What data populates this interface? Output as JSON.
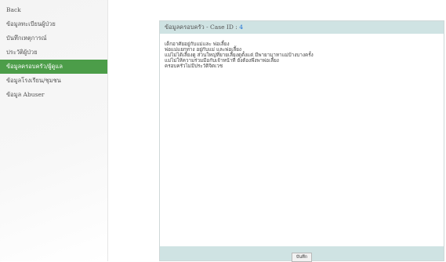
{
  "sidebar": {
    "items": [
      {
        "label": "Back",
        "active": false
      },
      {
        "label": "ข้อมูลทะเบียนผู้ป่วย",
        "active": false
      },
      {
        "label": "บันทึกเหตุการณ์",
        "active": false
      },
      {
        "label": "ประวัติผู้ป่วย",
        "active": false
      },
      {
        "label": "ข้อมูลครอบครัว/ผู้ดูแล",
        "active": true
      },
      {
        "label": "ข้อมูลโรงเรียน/ชุมชน",
        "active": false
      },
      {
        "label": "ข้อมูล Abuser",
        "active": false
      }
    ]
  },
  "panel": {
    "title_prefix": "ข้อมูลครอบครัว - Case ID : ",
    "case_id": "4",
    "notes": [
      "เด็กอาศัยอยู่กับแม่และ พ่อเลี้ยง",
      "พ่อแม่แยกทาง อยู่กับแม่ และพ่อเลี้ยง",
      "แม่ไม่ได้เลี้ยงดู ส่วนใหญ่ที่ยายเลี้ยงดูตั้งแต่ มีพายามาหาแม่บ้างบางครั้ง",
      "แม่ไม่ให้ความร่วมมือกับเจ้าหน้าที่ ยังต้องพึ่งพาพ่อเลี้ยง",
      "ครอบครัวไม่มีประวัติจิตเวช"
    ],
    "save_label": "บันทึก"
  },
  "colors": {
    "active_green": "#4c9d49",
    "header_teal": "#cfe3e3",
    "case_id_blue": "#1a6fd6"
  }
}
